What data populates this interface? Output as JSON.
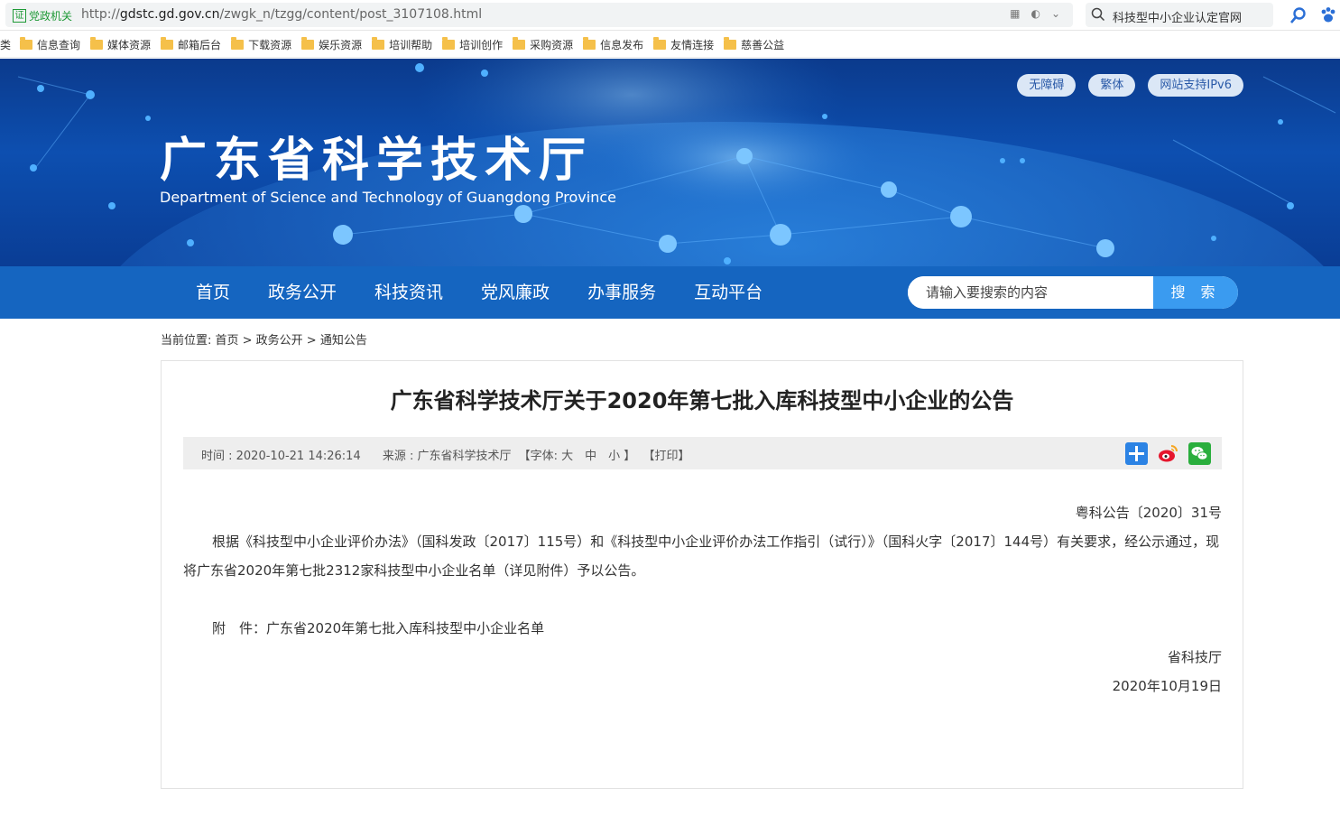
{
  "browser": {
    "gov_badge_icon": "证",
    "gov_badge": "党政机关",
    "url_prefix": "http://",
    "url_host": "gdstc.gd.gov.cn",
    "url_path": "/zwgk_n/tzgg/content/post_3107108.html",
    "search_query": "科技型中小企业认定官网",
    "bookmark_prefix": "类",
    "bookmarks": [
      "信息查询",
      "媒体资源",
      "邮箱后台",
      "下载资源",
      "娱乐资源",
      "培训帮助",
      "培训创作",
      "采购资源",
      "信息发布",
      "友情连接",
      "慈善公益"
    ]
  },
  "header": {
    "title": "广东省科学技术厅",
    "subtitle": "Department of Science and Technology of Guangdong Province",
    "links": [
      "无障碍",
      "繁体",
      "网站支持IPv6"
    ]
  },
  "nav": {
    "items": [
      "首页",
      "政务公开",
      "科技资讯",
      "党风廉政",
      "办事服务",
      "互动平台"
    ],
    "search_placeholder": "请输入要搜索的内容",
    "search_button": "搜 索"
  },
  "breadcrumb": "当前位置: 首页 > 政务公开 > 通知公告",
  "article": {
    "title": "广东省科学技术厅关于2020年第七批入库科技型中小企业的公告",
    "meta_time": "时间 : 2020-10-21 14:26:14",
    "meta_source": "来源 : 广东省科学技术厅",
    "meta_font": "【字体: 大　中　小 】",
    "meta_print": "【打印】",
    "doc_number": "粤科公告〔2020〕31号",
    "paragraph": "根据《科技型中小企业评价办法》（国科发政〔2017〕115号）和《科技型中小企业评价办法工作指引（试行）》（国科火字〔2017〕144号）有关要求，经公示通过，现将广东省2020年第七批2312家科技型中小企业名单（详见附件）予以公告。",
    "attachment": "附　件：广东省2020年第七批入库科技型中小企业名单",
    "signer": "省科技厅",
    "date": "2020年10月19日"
  },
  "colors": {
    "nav_bg": "#1565c0",
    "search_btn": "#3a9bf0",
    "banner_top": "#0b3a8c"
  }
}
